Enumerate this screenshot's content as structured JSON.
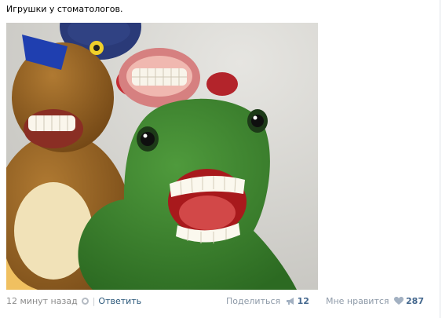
{
  "post": {
    "text": "Игрушки у стоматологов.",
    "image_alt": "Плюшевые игрушки с зубными протезами"
  },
  "footer": {
    "time": "12 минут назад",
    "separator": "|",
    "reply_label": "Ответить",
    "share_label": "Поделиться",
    "share_count": "12",
    "like_label": "Мне нравится",
    "like_count": "287"
  },
  "icons": {
    "settings": "gear-icon",
    "share": "megaphone-icon",
    "like": "heart-icon"
  },
  "colors": {
    "link": "#2b587a",
    "count": "#45688e",
    "muted": "#8c8c8c",
    "icon_gray": "#b5bbc3"
  }
}
